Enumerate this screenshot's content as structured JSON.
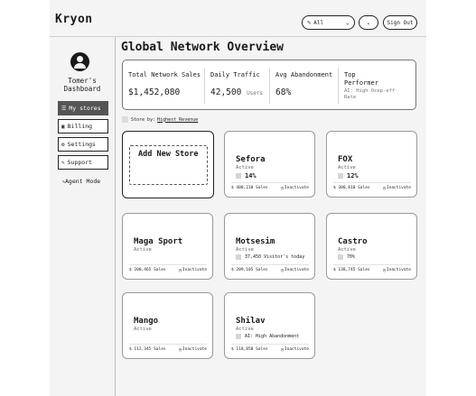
{
  "header": {
    "logo": "Kryon",
    "filter": {
      "icon": "pen-icon",
      "value": "All"
    },
    "dot_button": ".",
    "signout_label": "Sign Out"
  },
  "sidebar": {
    "title": "Tomer's Dashboard",
    "items": [
      {
        "label": "My stores",
        "icon": "list-icon",
        "active": true
      },
      {
        "label": "Billing",
        "icon": "card-icon",
        "active": false
      },
      {
        "label": "Settings",
        "icon": "gear-icon",
        "active": false
      },
      {
        "label": "Support",
        "icon": "pen-icon",
        "active": false
      }
    ],
    "agent_mode": "Agent Mode"
  },
  "main": {
    "title": "Global Network Overview",
    "stats": {
      "total_sales": {
        "label": "Total Network Sales",
        "value": "$1,452,080"
      },
      "daily_traffic": {
        "label": "Daily Traffic",
        "value": "42,500",
        "unit": "Users"
      },
      "avg_abandonment": {
        "label": "Avg Abandonment",
        "value": "68%"
      },
      "top_performer": {
        "label": "Top Performer",
        "sub": "AI: High Ocep-eff Rate"
      }
    },
    "sort": {
      "prefix": "Store by:",
      "value": "Highest Revenue"
    },
    "add_store": "Add New Store",
    "stores": [
      {
        "name": "Sefora",
        "status": "Active",
        "badge": "14%",
        "sales": "$ 408,210 Sales",
        "action": "Inactivate"
      },
      {
        "name": "FOX",
        "status": "Active",
        "badge": "12%",
        "sales": "$ 300,810 Sales",
        "action": "Inactivate"
      },
      {
        "name": "Maga Sport",
        "status": "Active",
        "badge": "",
        "sales": "$ 200,465 Sales",
        "action": "Inactivate"
      },
      {
        "name": "Motsesim",
        "status": "Active",
        "badge": "37,450 Visitor's today",
        "sales": "$ 209,105 Sales",
        "action": "Inactivate"
      },
      {
        "name": "Castro",
        "status": "Active",
        "badge": "70%",
        "sales": "$ 138,745 Sales",
        "action": "Inactivate"
      },
      {
        "name": "Mango",
        "status": "Active",
        "badge": "",
        "sales": "$ 112,345 Sales",
        "action": "Inactivate"
      },
      {
        "name": "Shilav",
        "status": "Active",
        "badge": "AI: High Abandonment",
        "sales": "$ 118,850 Sales",
        "action": "Inactivate"
      }
    ]
  }
}
